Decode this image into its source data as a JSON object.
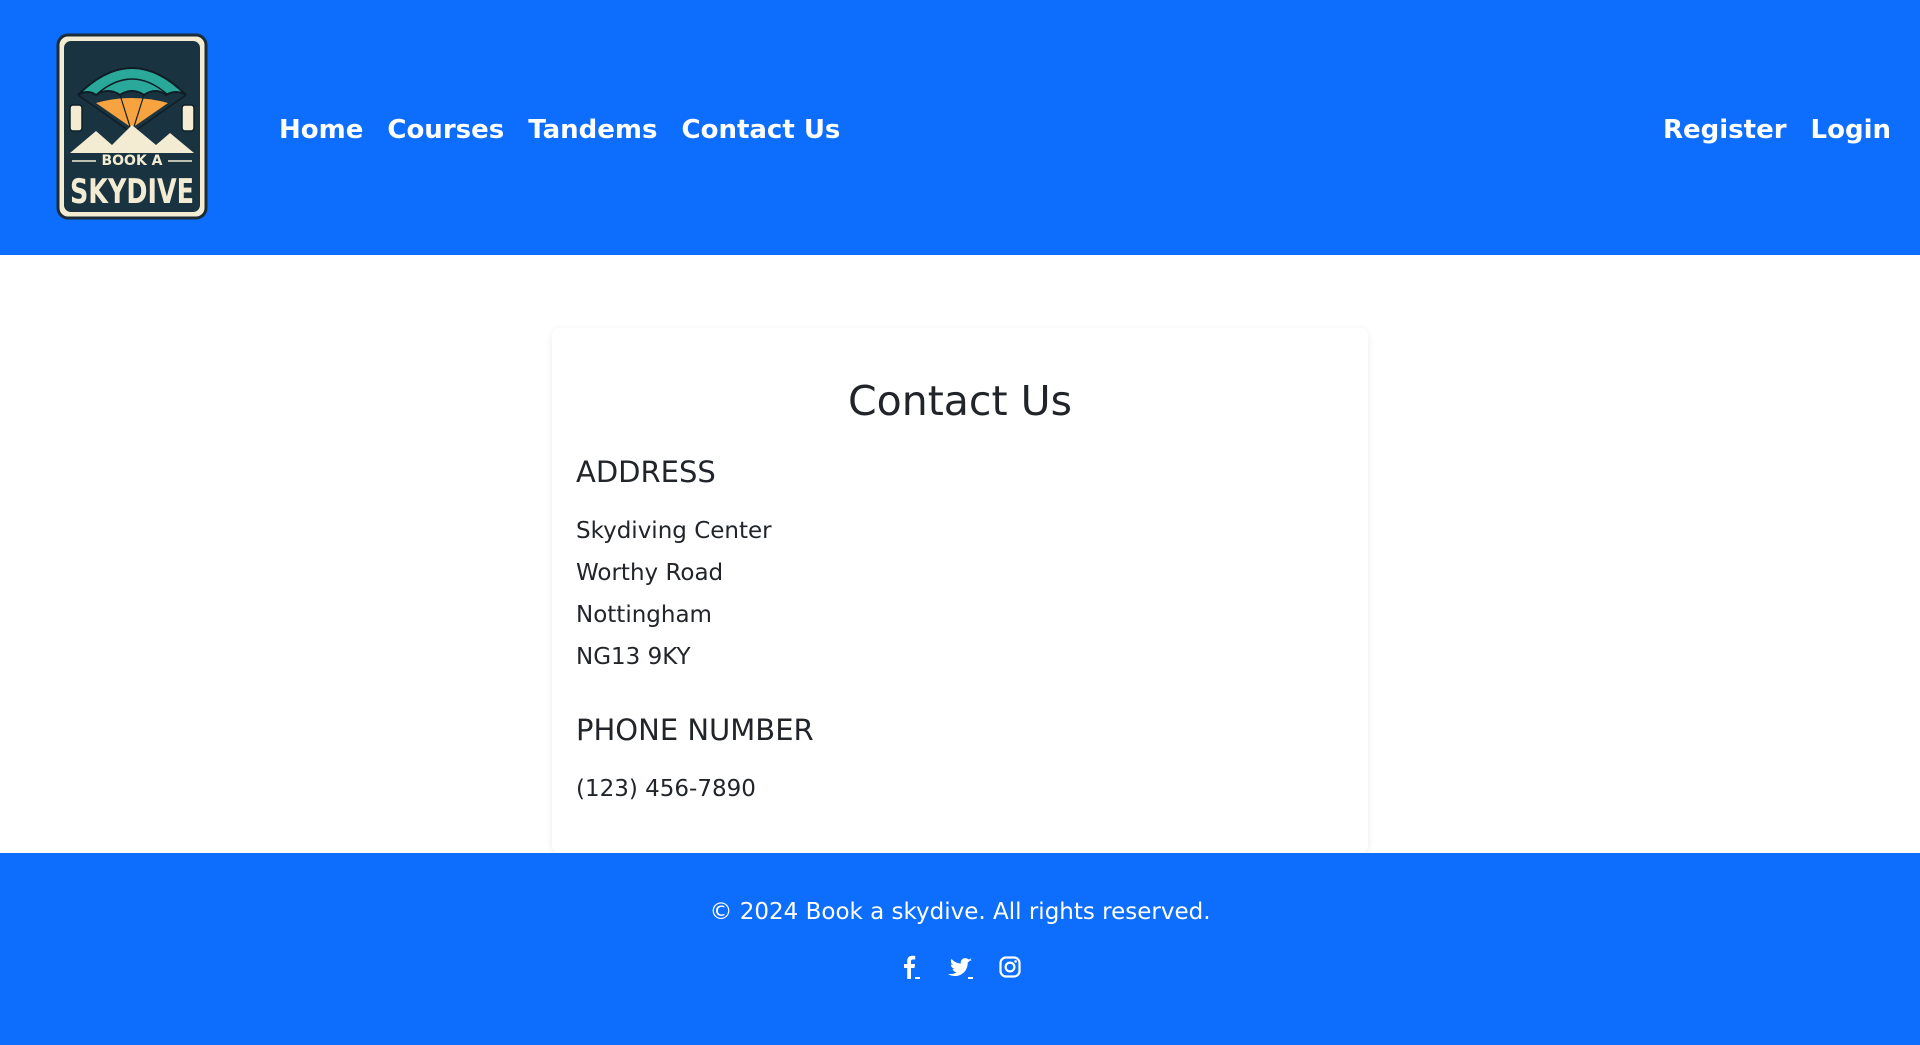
{
  "brand": {
    "logo_top_text": "BOOK A",
    "logo_main_text": "SKYDIVE"
  },
  "nav": {
    "left": [
      "Home",
      "Courses",
      "Tandems",
      "Contact Us"
    ],
    "right": [
      "Register",
      "Login"
    ]
  },
  "contact": {
    "title": "Contact Us",
    "address_heading": "ADDRESS",
    "address_lines": [
      "Skydiving Center",
      "Worthy Road",
      "Nottingham",
      "NG13 9KY"
    ],
    "phone_heading": "PHONE NUMBER",
    "phone": "(123) 456-7890"
  },
  "footer": {
    "copyright": "© 2024 Book a skydive. All rights reserved.",
    "social_icons": [
      "facebook-icon",
      "twitter-icon",
      "instagram-icon"
    ]
  },
  "colors": {
    "primary": "#0d6efd",
    "text": "#212529",
    "white": "#ffffff"
  }
}
